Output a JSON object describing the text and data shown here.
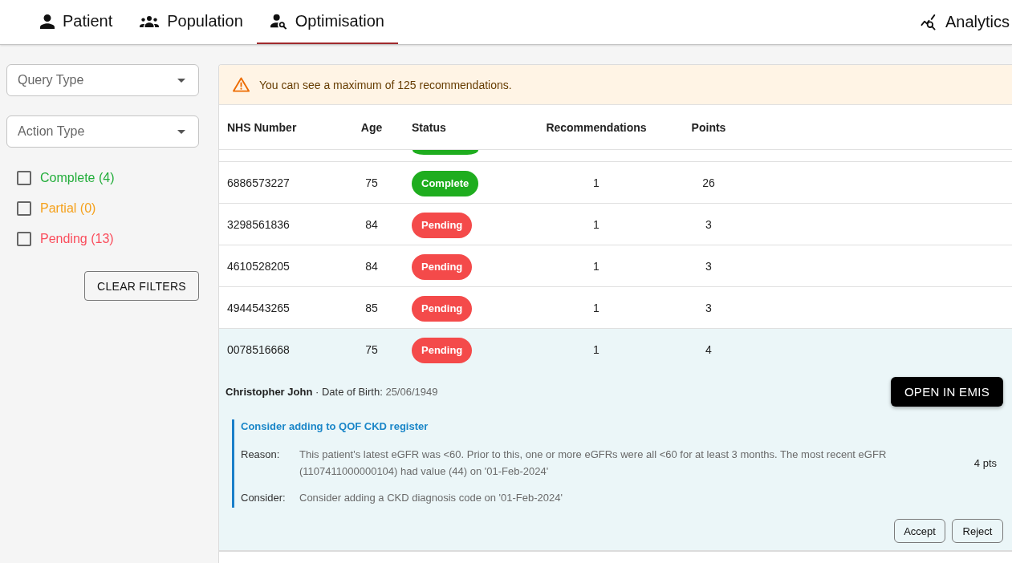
{
  "nav": {
    "tabs": [
      {
        "label": "Patient",
        "selected": false
      },
      {
        "label": "Population",
        "selected": false
      },
      {
        "label": "Optimisation",
        "selected": true
      }
    ],
    "analytics_link": {
      "label": "Analytics"
    }
  },
  "filters": {
    "selects": [
      {
        "placeholder": "Query Type"
      },
      {
        "placeholder": "Action Type"
      }
    ],
    "status_checks": [
      {
        "label": "Complete (4)",
        "checked": false,
        "color": "#22ad3a"
      },
      {
        "label": "Partial (0)",
        "checked": false,
        "color": "#f5a11c"
      },
      {
        "label": "Pending (13)",
        "checked": false,
        "color": "#fa4d5c"
      }
    ],
    "clear_button": "CLEAR FILTERS"
  },
  "banner": {
    "kind": "warning",
    "message": "You can see a maximum of 125 recommendations."
  },
  "table": {
    "columns": [
      "NHS Number",
      "Age",
      "Status",
      "Recommendations",
      "Points"
    ],
    "clipped_row": {
      "kind": "complete"
    },
    "rows": [
      {
        "nhs_number": "6886573227",
        "age": "75",
        "kind": "complete",
        "status_label": "Complete",
        "recommendations": "1",
        "points": "26",
        "expanded": false
      },
      {
        "nhs_number": "3298561836",
        "age": "84",
        "kind": "pending",
        "status_label": "Pending",
        "recommendations": "1",
        "points": "3",
        "expanded": false
      },
      {
        "nhs_number": "4610528205",
        "age": "84",
        "kind": "pending",
        "status_label": "Pending",
        "recommendations": "1",
        "points": "3",
        "expanded": false
      },
      {
        "nhs_number": "4944543265",
        "age": "85",
        "kind": "pending",
        "status_label": "Pending",
        "recommendations": "1",
        "points": "3",
        "expanded": false
      },
      {
        "nhs_number": "0078516668",
        "age": "75",
        "kind": "pending",
        "status_label": "Pending",
        "recommendations": "1",
        "points": "4",
        "expanded": true,
        "detail": {
          "patient_name": "Christopher John",
          "dob_label": "· Date of Birth:",
          "dob": "25/06/1949",
          "open_button": "OPEN IN EMIS",
          "recommendations": [
            {
              "title": "Consider adding to QOF CKD register",
              "fields": [
                {
                  "label": "Reason:",
                  "text": "This patient's latest eGFR was <60. Prior to this, one or more eGFRs were all <60 for at least 3 months. The most recent eGFR (1107411000000104) had value (44) on '01-Feb-2024'"
                },
                {
                  "label": "Consider:",
                  "text": "Consider adding a CKD diagnosis code on '01-Feb-2024'"
                }
              ],
              "points": "4 pts"
            }
          ],
          "actions": [
            "Accept",
            "Reject"
          ]
        }
      }
    ]
  }
}
